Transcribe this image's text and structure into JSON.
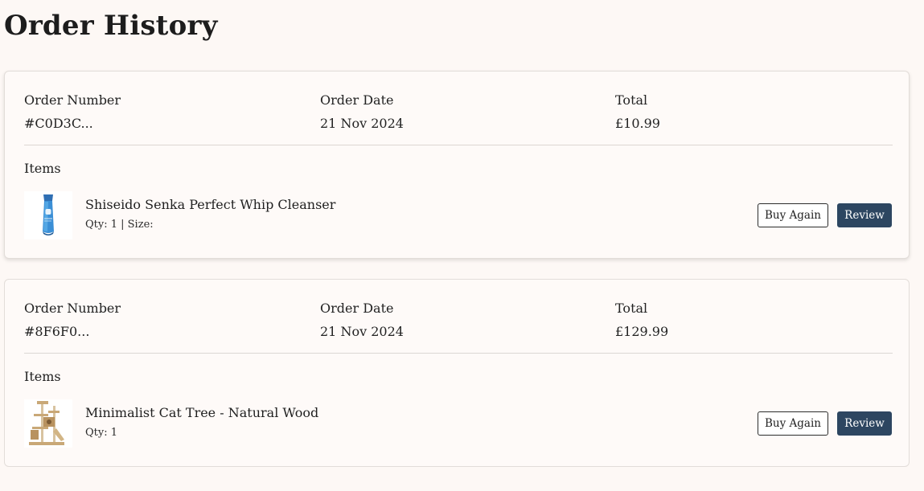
{
  "page": {
    "title": "Order History"
  },
  "labels": {
    "order_number": "Order Number",
    "order_date": "Order Date",
    "total": "Total",
    "items": "Items",
    "buy_again": "Buy Again",
    "review": "Review"
  },
  "orders": [
    {
      "number": "#C0D3C...",
      "date": "21 Nov 2024",
      "total": "£10.99",
      "items": [
        {
          "name": "Shiseido Senka Perfect Whip Cleanser",
          "details": "Qty: 1 | Size:",
          "thumbnail": "cleanser-tube-image"
        }
      ]
    },
    {
      "number": "#8F6F0...",
      "date": "21 Nov 2024",
      "total": "£129.99",
      "items": [
        {
          "name": "Minimalist Cat Tree - Natural Wood",
          "details": "Qty: 1",
          "thumbnail": "cat-tree-image"
        }
      ]
    }
  ],
  "colors": {
    "background": "#fdf8f5",
    "review_button": "#2d4661",
    "card_border": "#e2ddd9"
  }
}
